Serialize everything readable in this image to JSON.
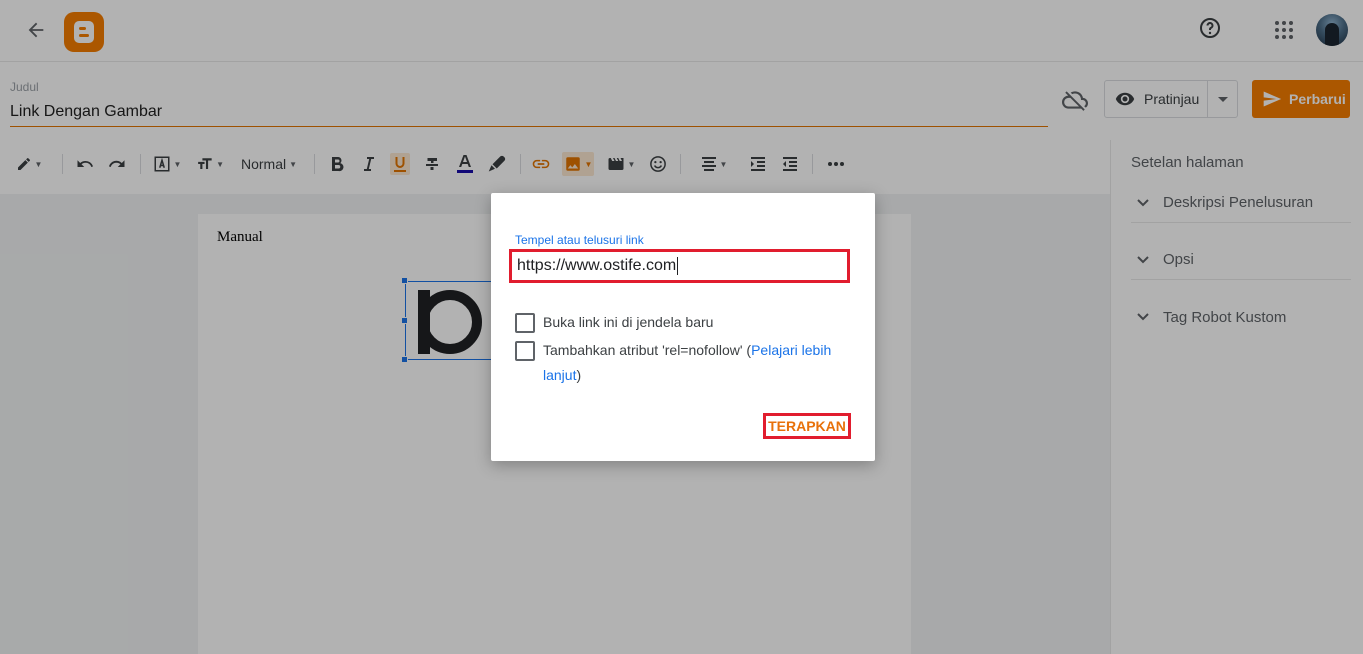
{
  "topbar": {
    "back_icon": "arrow-back-icon",
    "logo_icon": "blogger-logo-icon",
    "help_icon": "help-circle-icon",
    "apps_icon": "apps-grid-icon"
  },
  "post": {
    "title_label": "Judul",
    "title_value": "Link Dengan Gambar"
  },
  "actions": {
    "preview_label": "Pratinjau",
    "update_label": "Perbarui"
  },
  "toolbar": {
    "paragraph_style": "Normal"
  },
  "side_panel": {
    "title": "Setelan halaman",
    "items": [
      {
        "label": "Deskripsi Penelusuran"
      },
      {
        "label": "Opsi"
      },
      {
        "label": "Tag Robot Kustom"
      }
    ]
  },
  "editor": {
    "body_text": "Manual"
  },
  "link_dialog": {
    "input_label": "Tempel atau telusuri link",
    "input_value": "https://www.ostife.com",
    "checkbox_new_window": "Buka link ini di jendela baru",
    "checkbox_nofollow_pre": "Tambahkan atribut 'rel=nofollow' (",
    "checkbox_nofollow_link": "Pelajari lebih lanjut",
    "checkbox_nofollow_post": ")",
    "apply_label": "TERAPKAN"
  },
  "colors": {
    "brand": "#f57d00",
    "link": "#1a73e8",
    "highlight_box": "#e11d2e"
  }
}
